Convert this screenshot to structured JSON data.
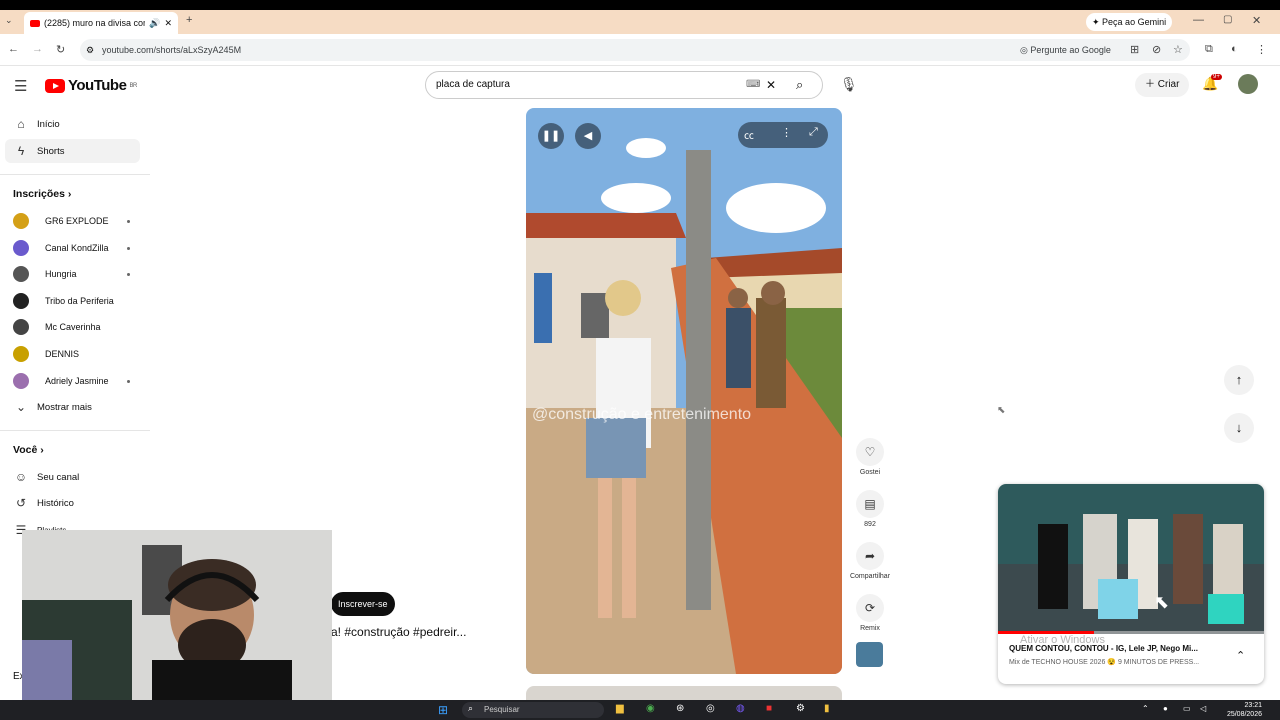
{
  "browser": {
    "tab_title": "(2285) muro na divisa com",
    "url": "youtube.com/shorts/aLxSzyA245M",
    "gemini_button": "Peça ao Gemini",
    "ask_google": "Pergunte ao Google"
  },
  "youtube": {
    "logo_text": "YouTube",
    "region": "BR",
    "search_value": "placa de captura",
    "create_label": "Criar",
    "notification_count": "9+"
  },
  "sidebar": {
    "items": [
      {
        "label": "Início",
        "icon": "home-icon"
      },
      {
        "label": "Shorts",
        "icon": "shorts-icon"
      }
    ],
    "subscriptions_title": "Inscrições",
    "subscriptions": [
      {
        "name": "GR6 EXPLODE",
        "color": "#d4a017",
        "dot": true
      },
      {
        "name": "Canal KondZilla",
        "color": "#6a5acd",
        "dot": true
      },
      {
        "name": "Hungria",
        "color": "#555555",
        "dot": true
      },
      {
        "name": "Tribo da Periferia",
        "color": "#222222",
        "dot": false
      },
      {
        "name": "Mc Caverinha",
        "color": "#444444",
        "dot": false
      },
      {
        "name": "DENNIS",
        "color": "#c8a000",
        "dot": false
      },
      {
        "name": "Adriely Jasmine",
        "color": "#9b6fae",
        "dot": true
      }
    ],
    "show_more": "Mostrar mais",
    "you_title": "Você",
    "you_items": [
      {
        "label": "Seu canal",
        "icon": "user-icon"
      },
      {
        "label": "Histórico",
        "icon": "history-icon"
      },
      {
        "label": "Playlists",
        "icon": "playlist-icon"
      }
    ],
    "partial_item": "Ex"
  },
  "short": {
    "watermark": "@construção e entretenimento",
    "subscribe_label": "Inscrever-se",
    "caption": "a! #construção #pedreir...",
    "actions": [
      {
        "label": "Gostei",
        "icon": "heart-icon"
      },
      {
        "label": "892",
        "icon": "comment-icon"
      },
      {
        "label": "Compartilhar",
        "icon": "share-icon"
      },
      {
        "label": "Remix",
        "icon": "remix-icon"
      }
    ]
  },
  "miniplayer": {
    "title": "QUEM CONTOU, CONTOU - IG, Lele JP, Nego Mi...",
    "subtitle": "Mix de TECHNO HOUSE 2026 😵 9 MINUTOS DE PRESS...",
    "overlay_text": "Ativar o Windows",
    "progress": 0.36
  },
  "taskbar": {
    "search_placeholder": "Pesquisar",
    "time": "23:21",
    "date": "25/08/2026"
  }
}
